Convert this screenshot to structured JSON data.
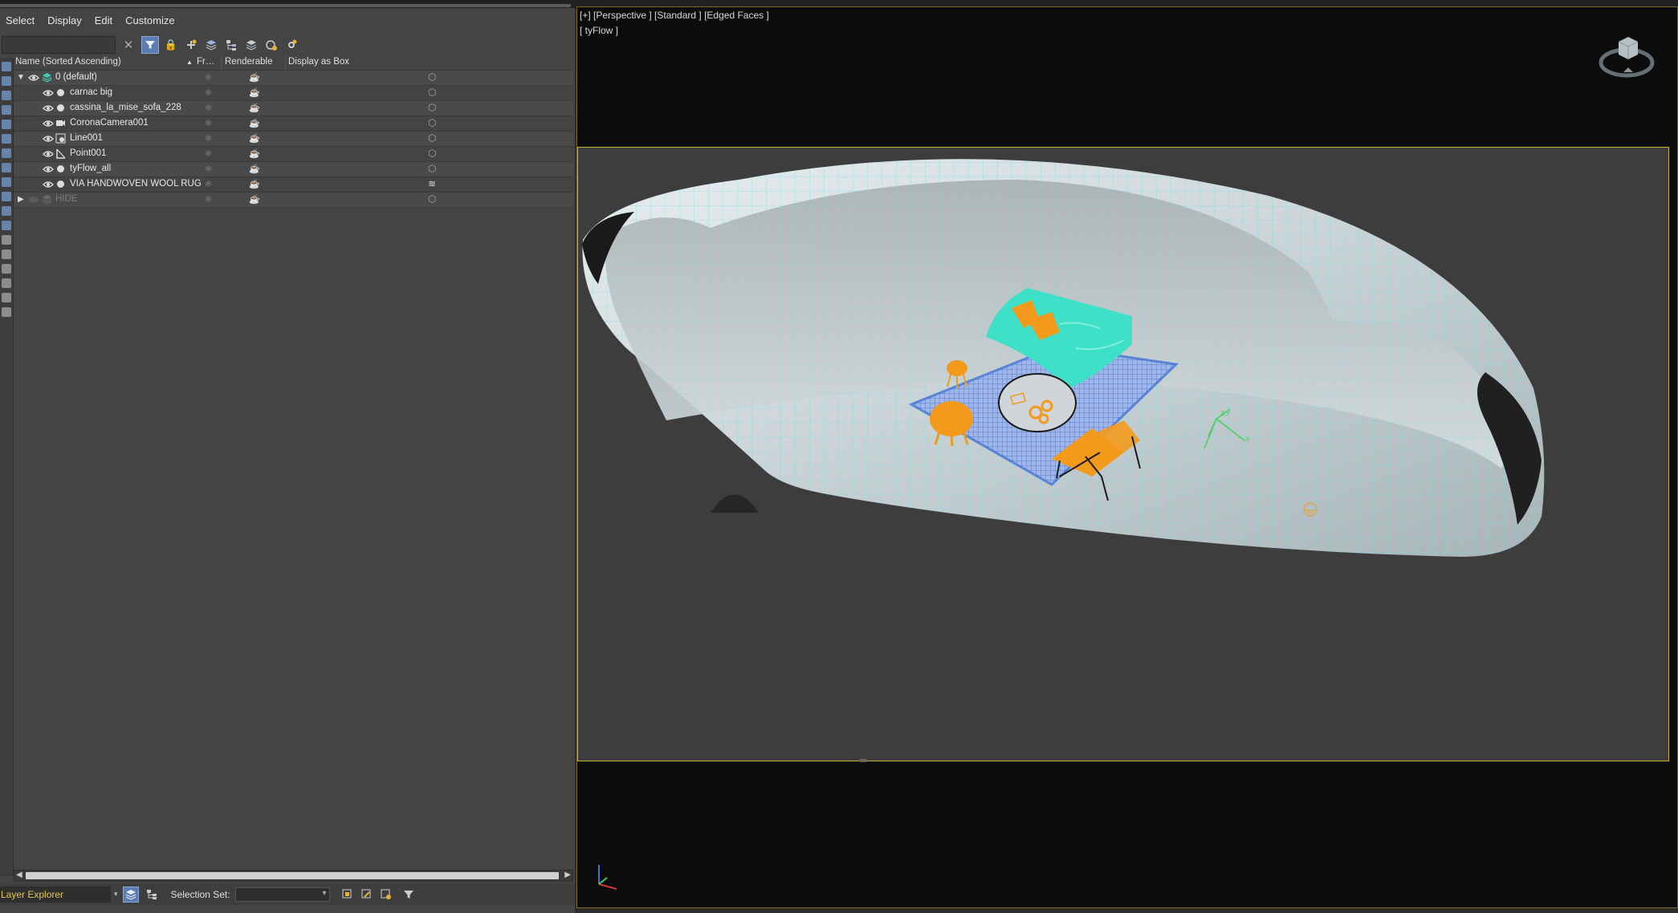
{
  "menu": [
    "Select",
    "Display",
    "Edit",
    "Customize"
  ],
  "toolbar": {
    "search_placeholder": "",
    "clear_icon": "clear-icon",
    "filter_icon": "filter-icon"
  },
  "columns": {
    "name": "Name (Sorted Ascending)",
    "sort_indicator": "▲",
    "frozen": "Fr…",
    "renderable": "Renderable",
    "display_as_box": "Display as Box"
  },
  "layers": [
    {
      "name": "0 (default)",
      "type": "layer",
      "level": 0,
      "expanded": true,
      "visible": true
    },
    {
      "name": "carnac big",
      "type": "geometry",
      "level": 1,
      "visible": true
    },
    {
      "name": "cassina_la_mise_sofa_228",
      "type": "geometry",
      "level": 1,
      "visible": true
    },
    {
      "name": "CoronaCamera001",
      "type": "camera",
      "level": 1,
      "visible": true
    },
    {
      "name": "Line001",
      "type": "shape",
      "level": 1,
      "visible": true
    },
    {
      "name": "Point001",
      "type": "helper",
      "level": 1,
      "visible": true
    },
    {
      "name": "tyFlow_all",
      "type": "geometry",
      "level": 1,
      "visible": true
    },
    {
      "name": "VIA HANDWOVEN WOOL RUG",
      "type": "geometry",
      "level": 1,
      "visible": true
    },
    {
      "name": "HIDE",
      "type": "layer",
      "level": 0,
      "expanded": false,
      "visible": false
    }
  ],
  "bottom": {
    "explorer": "Layer Explorer",
    "selection_set_label": "Selection Set:",
    "selection_set_value": ""
  },
  "viewport": {
    "label": "[+] [Perspective ] [Standard ] [Edged Faces ]",
    "label2": "[ tyFlow ]",
    "border_color": "#c8b030",
    "accent_orange": "#f39a1c",
    "accent_teal": "#3fe0c8"
  }
}
